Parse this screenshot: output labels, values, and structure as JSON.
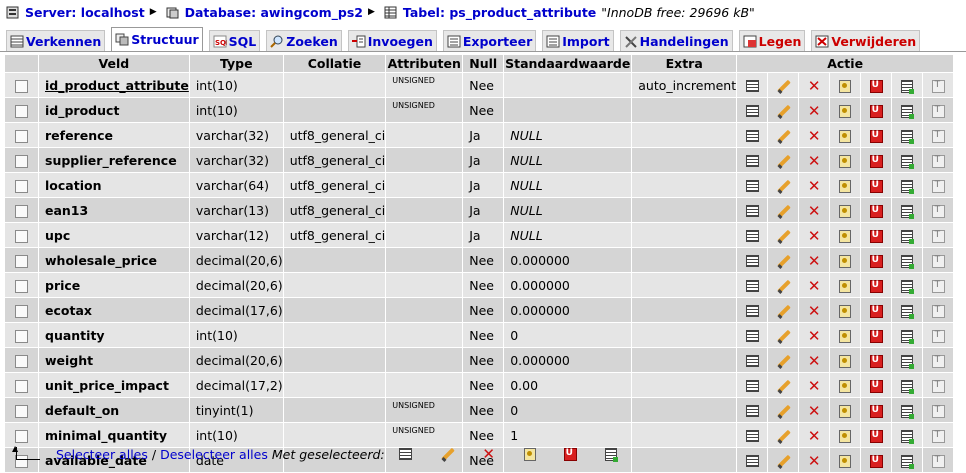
{
  "breadcrumb": {
    "server": "Server: localhost",
    "database": "Database: awingcom_ps2",
    "table": "Tabel: ps_product_attribute",
    "innodb": "\"InnoDB free: 29696 kB\""
  },
  "tabs": [
    {
      "label": "Verkennen",
      "active": false
    },
    {
      "label": "Structuur",
      "active": true
    },
    {
      "label": "SQL",
      "active": false
    },
    {
      "label": "Zoeken",
      "active": false
    },
    {
      "label": "Invoegen",
      "active": false
    },
    {
      "label": "Exporteer",
      "active": false
    },
    {
      "label": "Import",
      "active": false
    },
    {
      "label": "Handelingen",
      "active": false
    },
    {
      "label": "Legen",
      "active": false
    },
    {
      "label": "Verwijderen",
      "active": false
    }
  ],
  "columns": {
    "veld": "Veld",
    "type": "Type",
    "collatie": "Collatie",
    "attributen": "Attributen",
    "null": "Null",
    "standaard": "Standaardwaarde",
    "extra": "Extra",
    "actie": "Actie"
  },
  "rows": [
    {
      "field": "id_product_attribute",
      "type": "int(10)",
      "collation": "",
      "attributes": "UNSIGNED",
      "null": "Nee",
      "default": "",
      "extra": "auto_increment"
    },
    {
      "field": "id_product",
      "type": "int(10)",
      "collation": "",
      "attributes": "UNSIGNED",
      "null": "Nee",
      "default": "",
      "extra": ""
    },
    {
      "field": "reference",
      "type": "varchar(32)",
      "collation": "utf8_general_ci",
      "attributes": "",
      "null": "Ja",
      "default": "NULL",
      "extra": ""
    },
    {
      "field": "supplier_reference",
      "type": "varchar(32)",
      "collation": "utf8_general_ci",
      "attributes": "",
      "null": "Ja",
      "default": "NULL",
      "extra": ""
    },
    {
      "field": "location",
      "type": "varchar(64)",
      "collation": "utf8_general_ci",
      "attributes": "",
      "null": "Ja",
      "default": "NULL",
      "extra": ""
    },
    {
      "field": "ean13",
      "type": "varchar(13)",
      "collation": "utf8_general_ci",
      "attributes": "",
      "null": "Ja",
      "default": "NULL",
      "extra": ""
    },
    {
      "field": "upc",
      "type": "varchar(12)",
      "collation": "utf8_general_ci",
      "attributes": "",
      "null": "Ja",
      "default": "NULL",
      "extra": ""
    },
    {
      "field": "wholesale_price",
      "type": "decimal(20,6)",
      "collation": "",
      "attributes": "",
      "null": "Nee",
      "default": "0.000000",
      "extra": ""
    },
    {
      "field": "price",
      "type": "decimal(20,6)",
      "collation": "",
      "attributes": "",
      "null": "Nee",
      "default": "0.000000",
      "extra": ""
    },
    {
      "field": "ecotax",
      "type": "decimal(17,6)",
      "collation": "",
      "attributes": "",
      "null": "Nee",
      "default": "0.000000",
      "extra": ""
    },
    {
      "field": "quantity",
      "type": "int(10)",
      "collation": "",
      "attributes": "",
      "null": "Nee",
      "default": "0",
      "extra": ""
    },
    {
      "field": "weight",
      "type": "decimal(20,6)",
      "collation": "",
      "attributes": "",
      "null": "Nee",
      "default": "0.000000",
      "extra": ""
    },
    {
      "field": "unit_price_impact",
      "type": "decimal(17,2)",
      "collation": "",
      "attributes": "",
      "null": "Nee",
      "default": "0.00",
      "extra": ""
    },
    {
      "field": "default_on",
      "type": "tinyint(1)",
      "collation": "",
      "attributes": "UNSIGNED",
      "null": "Nee",
      "default": "0",
      "extra": ""
    },
    {
      "field": "minimal_quantity",
      "type": "int(10)",
      "collation": "",
      "attributes": "UNSIGNED",
      "null": "Nee",
      "default": "1",
      "extra": ""
    },
    {
      "field": "available_date",
      "type": "date",
      "collation": "",
      "attributes": "",
      "null": "Nee",
      "default": "",
      "extra": ""
    }
  ],
  "row_actions": [
    "browse-icon",
    "edit-icon",
    "drop-icon",
    "primary-key-icon",
    "unique-icon",
    "index-icon",
    "fulltext-icon"
  ],
  "footer": {
    "select_all": "Selecteer alles",
    "separator": "/",
    "deselect_all": "Deselecteer alles",
    "with_selected": "Met geselecteerd:"
  }
}
